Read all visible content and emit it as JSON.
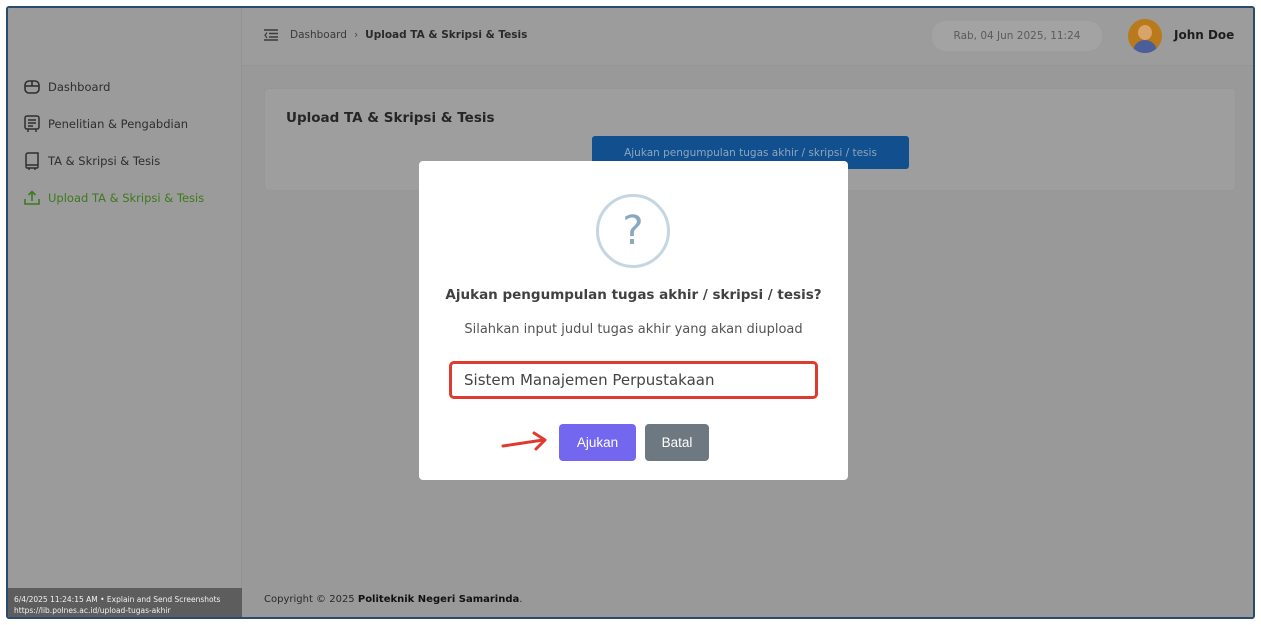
{
  "header": {
    "breadcrumb": [
      "Dashboard",
      "Upload TA & Skripsi & Tesis"
    ],
    "datetime": "Rab, 04 Jun 2025, 11:24",
    "user_name": "John Doe"
  },
  "sidebar": {
    "items": [
      {
        "label": "Dashboard",
        "icon": "dashboard-icon",
        "active": false
      },
      {
        "label": "Penelitian & Pengabdian",
        "icon": "research-icon",
        "active": false
      },
      {
        "label": "TA & Skripsi & Tesis",
        "icon": "thesis-icon",
        "active": false
      },
      {
        "label": "Upload TA & Skripsi & Tesis",
        "icon": "upload-icon",
        "active": true
      }
    ]
  },
  "main": {
    "card_title": "Upload TA & Skripsi & Tesis",
    "submit_button": "Ajukan pengumpulan tugas akhir / skripsi / tesis"
  },
  "footer": {
    "prefix": "Copyright © 2025 ",
    "org": "Politeknik Negeri Samarinda",
    "suffix": "."
  },
  "screenshot_overlay": {
    "line1": "6/4/2025 11:24:15 AM • Explain and Send Screenshots",
    "line2": "https://lib.polnes.ac.id/upload-tugas-akhir"
  },
  "modal": {
    "icon": "question-icon",
    "icon_glyph": "?",
    "title": "Ajukan pengumpulan tugas akhir / skripsi / tesis?",
    "text": "Silahkan input judul tugas akhir yang akan diupload",
    "input_value": "Sistem Manajemen Perpustakaan",
    "confirm_label": "Ajukan",
    "cancel_label": "Batal"
  },
  "colors": {
    "confirm": "#7367f0",
    "cancel": "#6e7881",
    "highlight": "#dd3a30",
    "active_nav": "#3d7a1c"
  }
}
